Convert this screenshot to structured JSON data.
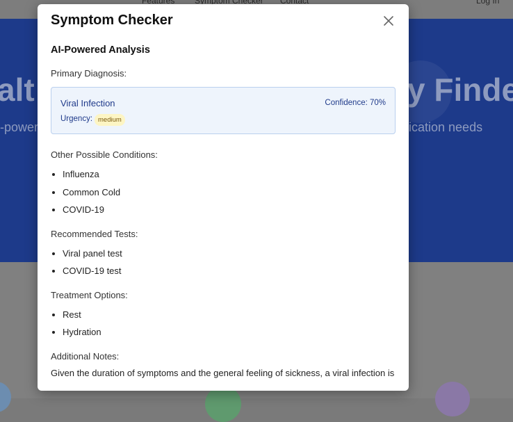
{
  "background": {
    "nav": {
      "features": "Features",
      "symptom_checker": "Symptom Checker",
      "contact": "Contact",
      "login": "Log In"
    },
    "hero_left": "alt",
    "hero_right": "y Finde",
    "sub_left": "-power",
    "sub_right": "ication needs"
  },
  "modal": {
    "title": "Symptom Checker",
    "analysis_heading": "AI-Powered Analysis",
    "primary_label": "Primary Diagnosis:",
    "primary": {
      "name": "Viral Infection",
      "confidence": "Confidence: 70%",
      "urgency_label": "Urgency:",
      "urgency": "medium"
    },
    "other_label": "Other Possible Conditions:",
    "other": [
      "Influenza",
      "Common Cold",
      "COVID-19"
    ],
    "tests_label": "Recommended Tests:",
    "tests": [
      "Viral panel test",
      "COVID-19 test"
    ],
    "treatment_label": "Treatment Options:",
    "treatment": [
      "Rest",
      "Hydration"
    ],
    "notes_label": "Additional Notes:",
    "notes": "Given the duration of symptoms and the general feeling of sickness, a viral infection is"
  },
  "colors": {
    "accent": "#1f3a8a",
    "diagnosis_bg": "#eef4fc",
    "urgency_badge": "#fdf5c4"
  }
}
